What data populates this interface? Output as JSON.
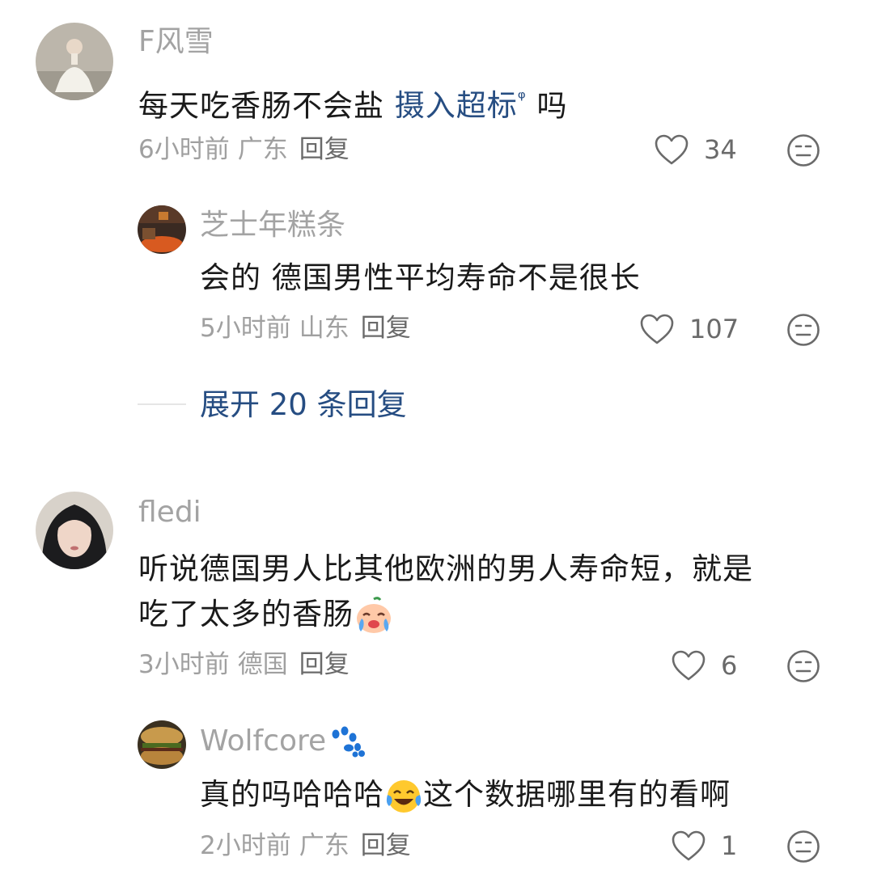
{
  "comments": [
    {
      "username": "F风雪",
      "text_before": "每天吃香肠不会盐 ",
      "link_text": "摄入超标",
      "search_glyph": "ᵠ",
      "text_after": " 吗",
      "time": "6小时前",
      "location": "广东",
      "reply_label": "回复",
      "likes": "34",
      "replies": [
        {
          "username": "芝士年糕条",
          "text": "会的 德国男性平均寿命不是很长",
          "time": "5小时前",
          "location": "山东",
          "reply_label": "回复",
          "likes": "107"
        }
      ],
      "expand_label": "展开 20 条回复"
    },
    {
      "username": "fledi",
      "text_line1": "听说德国男人比其他欧洲的男人寿命短，就是",
      "text_line2": "吃了太多的香肠",
      "emoji": "crying-face-emoji",
      "time": "3小时前",
      "location": "德国",
      "reply_label": "回复",
      "likes": "6",
      "replies": [
        {
          "username": "Wolfcore",
          "badge": "paw-icon",
          "text_before": "真的吗哈哈哈",
          "emoji": "tears-of-joy-emoji",
          "text_after": "这个数据哪里有的看啊",
          "time": "2小时前",
          "location": "广东",
          "reply_label": "回复",
          "likes": "1"
        }
      ]
    }
  ],
  "colors": {
    "link": "#264d82",
    "meta": "#a0a0a0",
    "username": "#a3a3a3",
    "text": "#1a1a1a"
  }
}
